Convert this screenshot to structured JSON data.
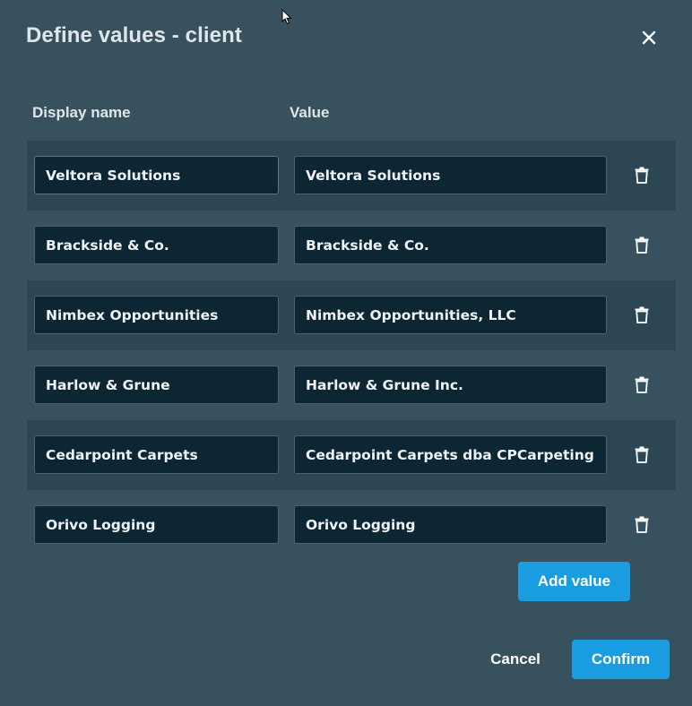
{
  "dialog": {
    "title": "Define values - client"
  },
  "columns": {
    "display_name": "Display name",
    "value": "Value"
  },
  "rows": [
    {
      "display_name": "Veltora Solutions",
      "value": "Veltora Solutions"
    },
    {
      "display_name": "Brackside & Co.",
      "value": "Brackside & Co."
    },
    {
      "display_name": "Nimbex Opportunities",
      "value": "Nimbex Opportunities, LLC"
    },
    {
      "display_name": "Harlow & Grune",
      "value": "Harlow & Grune Inc."
    },
    {
      "display_name": "Cedarpoint Carpets",
      "value": "Cedarpoint Carpets dba CPCarpeting"
    },
    {
      "display_name": "Orivo Logging",
      "value": "Orivo Logging"
    }
  ],
  "buttons": {
    "add_value": "Add value",
    "cancel": "Cancel",
    "confirm": "Confirm"
  },
  "icons": {
    "close": "close-icon",
    "delete": "trash-icon",
    "pointer": "mouse-pointer-icon"
  },
  "colors": {
    "background": "#37525e",
    "row_shade": "#2c4653",
    "input_bg": "#0c2634",
    "accent": "#1a9ce0"
  }
}
